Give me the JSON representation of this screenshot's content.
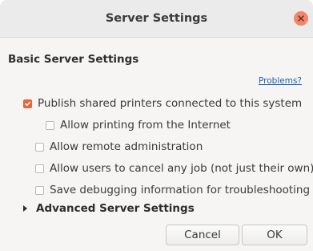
{
  "window": {
    "title": "Server Settings"
  },
  "section_title": "Basic Server Settings",
  "problems_link": "Problems?",
  "options": [
    {
      "label": "Publish shared printers connected to this system",
      "checked": true
    },
    {
      "label": "Allow printing from the Internet",
      "checked": false
    },
    {
      "label": "Allow remote administration",
      "checked": false
    },
    {
      "label": "Allow users to cancel any job (not just their own)",
      "checked": false
    },
    {
      "label": "Save debugging information for troubleshooting",
      "checked": false
    }
  ],
  "advanced": {
    "label": "Advanced Server Settings",
    "expanded": false
  },
  "buttons": {
    "cancel": "Cancel",
    "ok": "OK"
  },
  "colors": {
    "accent": "#e9643a",
    "close": "#f3866a",
    "link": "#1a5fb4"
  },
  "icons": {
    "close": "close-icon",
    "check": "check-icon",
    "expander": "triangle-right-icon"
  }
}
